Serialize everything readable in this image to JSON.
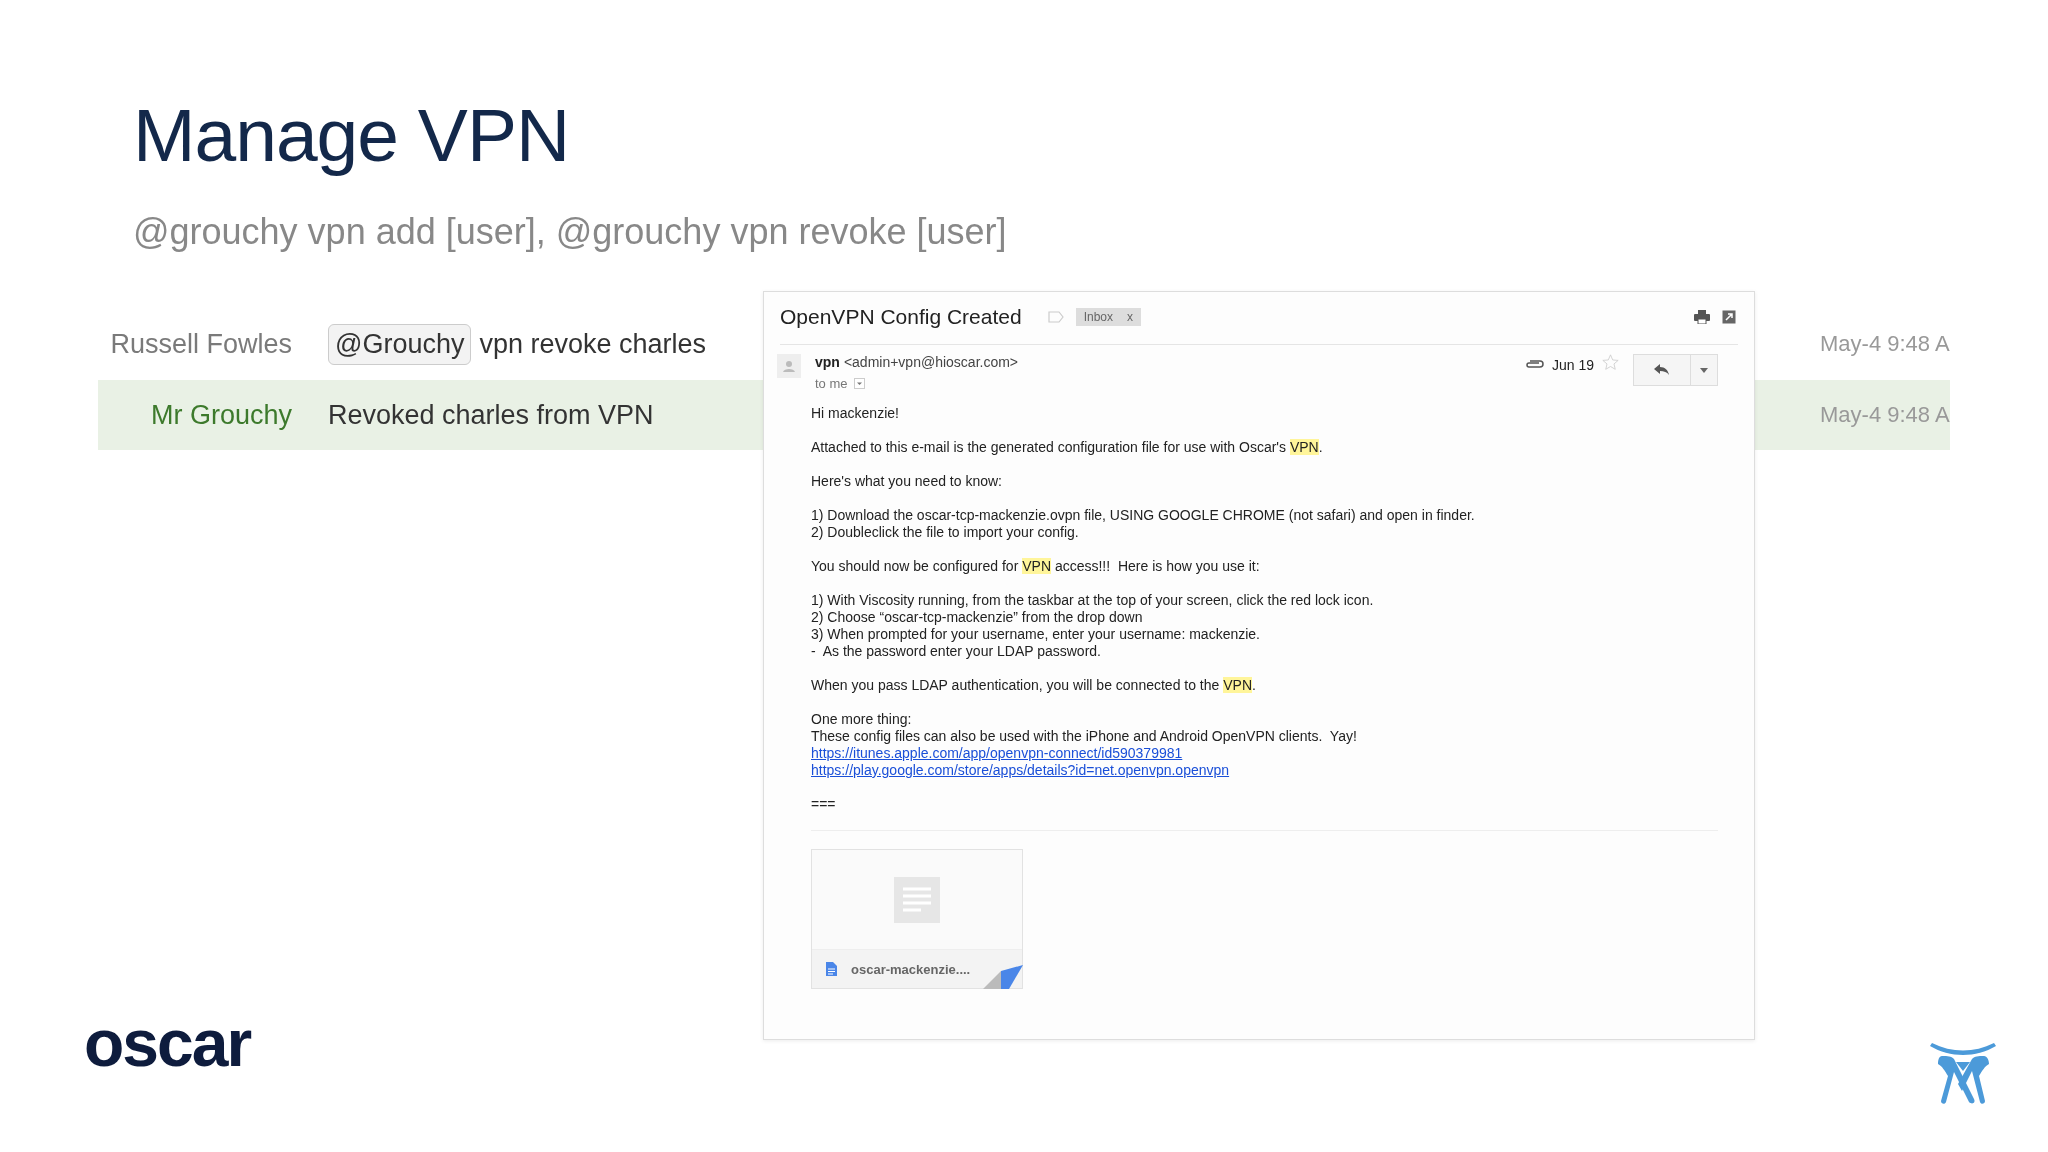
{
  "slide": {
    "title": "Manage VPN",
    "subtitle": "@grouchy vpn add [user], @grouchy vpn revoke [user]",
    "logo": "oscar"
  },
  "chat": {
    "messages": [
      {
        "kind": "user",
        "sender": "Russell Fowles",
        "mention": "@Grouchy",
        "text": "vpn revoke charles",
        "time": "May-4 9:48 A",
        "highlighted": false
      },
      {
        "kind": "bot",
        "sender": "Mr Grouchy",
        "text": "Revoked charles from VPN",
        "time": "May-4 9:48 A",
        "highlighted": true
      }
    ]
  },
  "email": {
    "subject": "OpenVPN Config Created",
    "label": "Inbox",
    "label_remove": "x",
    "sender_name": "vpn",
    "sender_address": "<admin+vpn@hioscar.com>",
    "recipient": "to me",
    "date": "Jun 19",
    "starred": false,
    "body": [
      [
        {
          "kind": "text",
          "segments": [
            {
              "text": "Hi mackenzie!",
              "highlighted": false
            }
          ]
        }
      ],
      [
        {
          "kind": "text",
          "segments": [
            {
              "text": "Attached to this e-mail is the generated configuration file for use with Oscar's ",
              "highlighted": false
            },
            {
              "text": "VPN",
              "highlighted": true
            },
            {
              "text": ".",
              "highlighted": false
            }
          ]
        }
      ],
      [
        {
          "kind": "text",
          "segments": [
            {
              "text": "Here's what you need to know:",
              "highlighted": false
            }
          ]
        }
      ],
      [
        {
          "kind": "text",
          "segments": [
            {
              "text": "1) Download the oscar-tcp-mackenzie.ovpn file, USING GOOGLE CHROME (not safari) and open in finder.",
              "highlighted": false
            }
          ]
        },
        {
          "kind": "text",
          "segments": [
            {
              "text": "2) Doubleclick the file to import your config.",
              "highlighted": false
            }
          ]
        }
      ],
      [
        {
          "kind": "text",
          "segments": [
            {
              "text": "You should now be configured for ",
              "highlighted": false
            },
            {
              "text": "VPN",
              "highlighted": true
            },
            {
              "text": " access!!!  Here is how you use it:",
              "highlighted": false
            }
          ]
        }
      ],
      [
        {
          "kind": "text",
          "segments": [
            {
              "text": "1) With Viscosity running, from the taskbar at the top of your screen, click the red lock icon.",
              "highlighted": false
            }
          ]
        },
        {
          "kind": "text",
          "segments": [
            {
              "text": "2) Choose “oscar-tcp-mackenzie” from the drop down",
              "highlighted": false
            }
          ]
        },
        {
          "kind": "text",
          "segments": [
            {
              "text": "3) When prompted for your username, enter your username: mackenzie.",
              "highlighted": false
            }
          ]
        },
        {
          "kind": "text",
          "segments": [
            {
              "text": "-  As the password enter your LDAP password.",
              "highlighted": false
            }
          ]
        }
      ],
      [
        {
          "kind": "text",
          "segments": [
            {
              "text": "When you pass LDAP authentication, you will be connected to the ",
              "highlighted": false
            },
            {
              "text": "VPN",
              "highlighted": true
            },
            {
              "text": ".",
              "highlighted": false
            }
          ]
        }
      ],
      [
        {
          "kind": "text",
          "segments": [
            {
              "text": "One more thing:",
              "highlighted": false
            }
          ]
        },
        {
          "kind": "text",
          "segments": [
            {
              "text": "These config files can also be used with the iPhone and Android OpenVPN clients.  Yay!",
              "highlighted": false
            }
          ]
        },
        {
          "kind": "link",
          "text": "https://itunes.apple.com/app/openvpn-connect/id590379981"
        },
        {
          "kind": "link",
          "text": "https://play.google.com/store/apps/details?id=net.openvpn.openvpn"
        }
      ],
      [
        {
          "kind": "text",
          "segments": [
            {
              "text": "===",
              "highlighted": false
            }
          ]
        }
      ]
    ],
    "attachment": {
      "name": "oscar-mackenzie...."
    }
  }
}
